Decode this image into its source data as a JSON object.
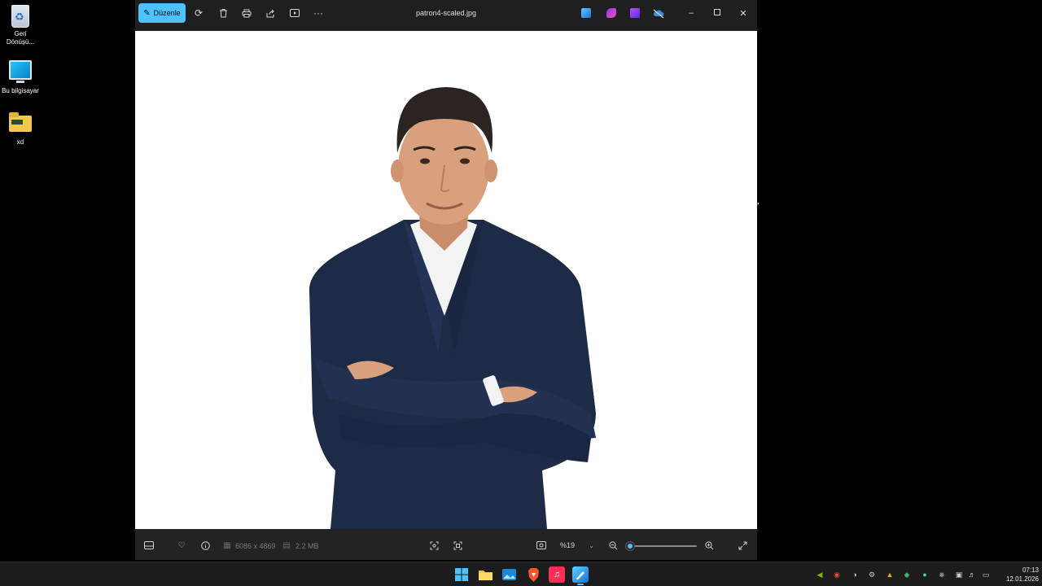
{
  "desktop": {
    "icons": [
      {
        "label": "Geri Dönüşü..."
      },
      {
        "label": "Bu bilgisayar"
      },
      {
        "label": "xd"
      }
    ]
  },
  "window": {
    "title": "patron4-scaled.jpg",
    "toolbar": {
      "edit_label": "Düzenle",
      "icons": [
        "edit-icon",
        "rotate-icon",
        "delete-icon",
        "print-icon",
        "share-icon",
        "slideshow-icon",
        "more-icon"
      ]
    },
    "app_shortcuts": [
      "photos-edit-app-icon",
      "clipchamp-icon",
      "designer-icon",
      "onedrive-icon"
    ],
    "controls": [
      "minimize-icon",
      "maximize-icon",
      "close-icon"
    ]
  },
  "status": {
    "dimensions": "6086 x 4869",
    "file_size": "2.2 MB",
    "zoom_value": "%19",
    "zoom_level": 0.02
  },
  "taskbar": {
    "apps": [
      "start-icon",
      "file-explorer-icon",
      "photos-app-icon",
      "brave-icon",
      "music-icon",
      "photos-icon"
    ],
    "active_app": "photos-icon",
    "clock_time": "07:13",
    "clock_date": "12.01.2026"
  },
  "colors": {
    "accent": "#4cc2ff",
    "window_bg": "#1f1f1f",
    "suit": "#1e2b47",
    "skin": "#d9a07e"
  }
}
